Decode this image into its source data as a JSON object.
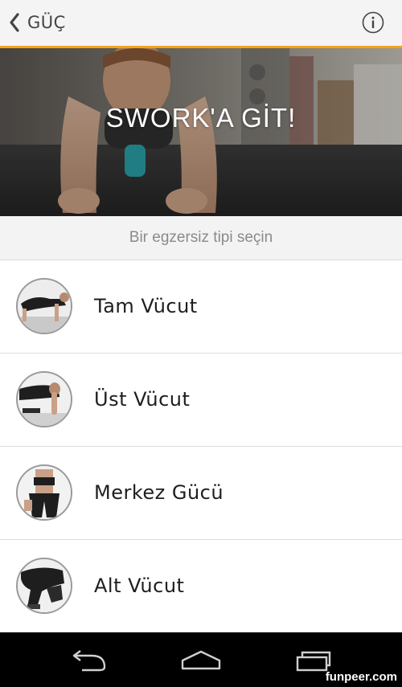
{
  "header": {
    "back_label": "GÜÇ",
    "back_icon": "chevron-left-icon",
    "info_icon": "info-icon",
    "accent_color": "#f5a21b"
  },
  "hero": {
    "title": "SWORK'A GİT!"
  },
  "subtitle": "Bir egzersiz tipi seçin",
  "exercise_types": [
    {
      "label": "Tam Vücut"
    },
    {
      "label": "Üst Vücut"
    },
    {
      "label": "Merkez Gücü"
    },
    {
      "label": "Alt Vücut"
    }
  ],
  "navbar": {
    "back_icon": "nav-back-icon",
    "home_icon": "nav-home-icon",
    "recents_icon": "nav-recents-icon"
  },
  "watermark": "funpeer.com"
}
